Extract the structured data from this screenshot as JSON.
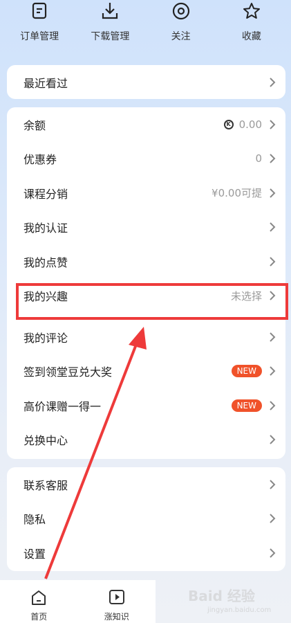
{
  "top_menu": [
    {
      "label": "订单管理",
      "icon": "order-icon"
    },
    {
      "label": "下载管理",
      "icon": "download-icon"
    },
    {
      "label": "关注",
      "icon": "follow-icon"
    },
    {
      "label": "收藏",
      "icon": "star-icon"
    }
  ],
  "recent": {
    "label": "最近看过"
  },
  "account_rows": [
    {
      "label": "余额",
      "value": "0.00",
      "type": "coin"
    },
    {
      "label": "优惠券",
      "value": "0"
    },
    {
      "label": "课程分销",
      "value": "¥0.00可提"
    },
    {
      "label": "我的认证",
      "value": ""
    },
    {
      "label": "我的点赞",
      "value": ""
    },
    {
      "label": "我的兴趣",
      "value": "未选择"
    },
    {
      "label": "我的评论",
      "value": ""
    },
    {
      "label": "签到领堂豆兑大奖",
      "badge": "NEW"
    },
    {
      "label": "高价课赠一得一",
      "badge": "NEW"
    },
    {
      "label": "兑换中心",
      "value": ""
    }
  ],
  "support_rows": [
    {
      "label": "联系客服"
    },
    {
      "label": "隐私"
    },
    {
      "label": "设置"
    }
  ],
  "tabbar": [
    {
      "label": "首页",
      "icon": "home-icon"
    },
    {
      "label": "涨知识",
      "icon": "video-icon"
    }
  ],
  "watermark": {
    "main": "Baid 经验",
    "sub": "jingyan.baidu.com"
  },
  "colors": {
    "accent": "#f0522a",
    "highlight": "#ee3a3a"
  }
}
